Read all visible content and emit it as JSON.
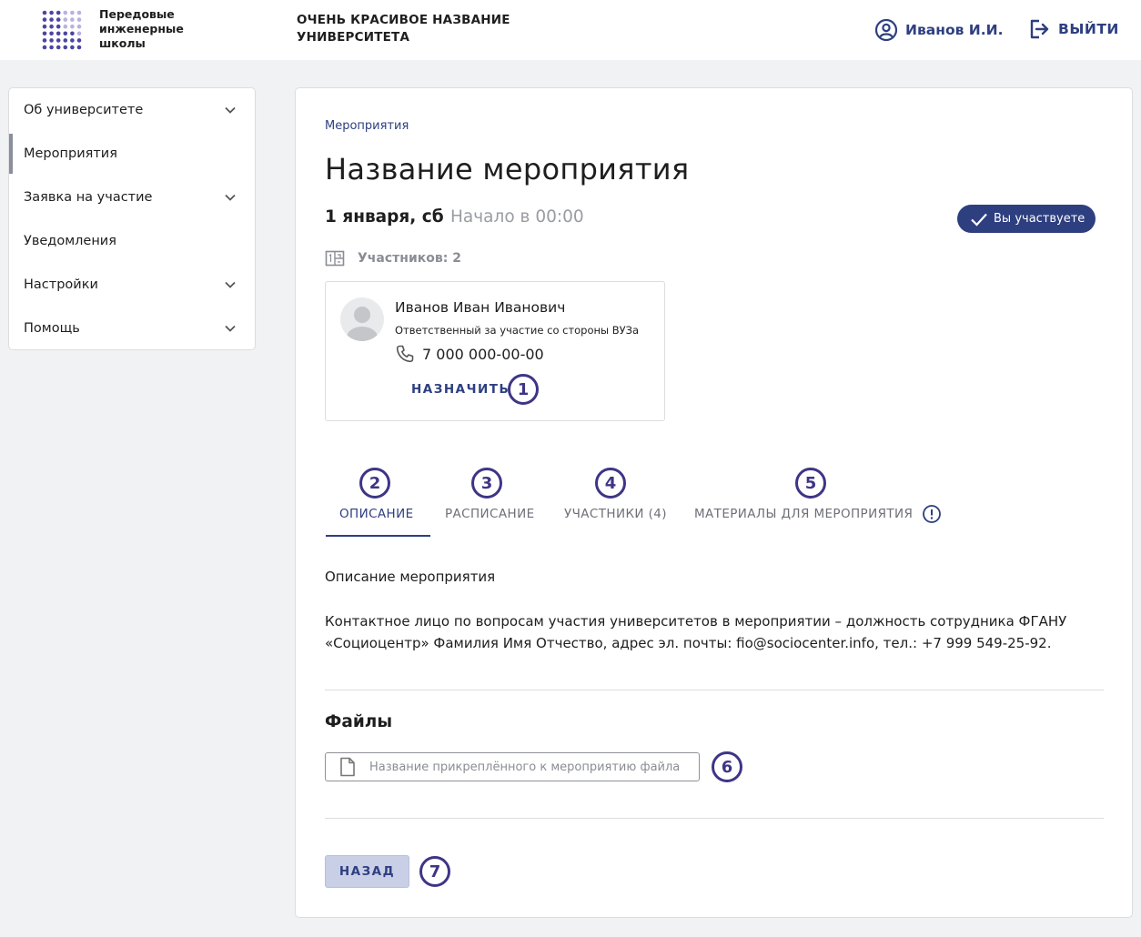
{
  "header": {
    "logo_text": [
      "Передовые",
      "инженерные",
      "школы"
    ],
    "university_name": [
      "ОЧЕНЬ КРАСИВОЕ НАЗВАНИЕ",
      "УНИВЕРСИТЕТА"
    ],
    "user_name": "Иванов И.И.",
    "user_icon": "user-circle-icon",
    "logout_label": "ВЫЙТИ",
    "logout_icon": "logout-icon"
  },
  "sidebar": {
    "items": [
      {
        "label": "Об университете",
        "has_chevron": true,
        "active": false
      },
      {
        "label": "Мероприятия",
        "has_chevron": false,
        "active": true
      },
      {
        "label": "Заявка на участие",
        "has_chevron": true,
        "active": false
      },
      {
        "label": "Уведомления",
        "has_chevron": false,
        "active": false
      },
      {
        "label": "Настройки",
        "has_chevron": true,
        "active": false
      },
      {
        "label": "Помощь",
        "has_chevron": true,
        "active": false
      }
    ]
  },
  "event": {
    "breadcrumb": "Мероприятия",
    "title": "Название мероприятия",
    "date": "1 января, сб",
    "start_time": "Начало в 00:00",
    "status_badge": "Вы участвуете",
    "participants_label": "Участников: 2",
    "contact": {
      "name": "Иванов Иван Иванович",
      "role": "Ответственный за участие со стороны ВУЗа",
      "phone": "7 000 000-00-00",
      "assign_label": "НАЗНАЧИТЬ"
    },
    "tabs": [
      {
        "label": "ОПИСАНИЕ",
        "active": true
      },
      {
        "label": "РАСПИСАНИЕ",
        "active": false
      },
      {
        "label": "УЧАСТНИКИ (4)",
        "active": false
      },
      {
        "label": "МАТЕРИАЛЫ ДЛЯ МЕРОПРИЯТИЯ",
        "active": false,
        "alert_icon": "exclamation-circle-icon"
      }
    ],
    "description_title": "Описание мероприятия",
    "description_text": "Контактное лицо по вопросам участия университетов в мероприятии – должность сотрудника ФГАНУ «Социоцентр» Фамилия Имя Отчество, адрес эл. почты: fio@sociocenter.info, тел.: +7 999 549-25-92.",
    "files_title": "Файлы",
    "file_name": "Название прикреплённого к мероприятию файла",
    "back_label": "НАЗАД"
  },
  "markers": [
    "1",
    "2",
    "3",
    "4",
    "5",
    "6",
    "7"
  ],
  "colors": {
    "accent": "#2e3f80",
    "marker": "#3e3586",
    "badge_bg": "#2e3f80",
    "back_button_bg": "#c9cfe6"
  }
}
